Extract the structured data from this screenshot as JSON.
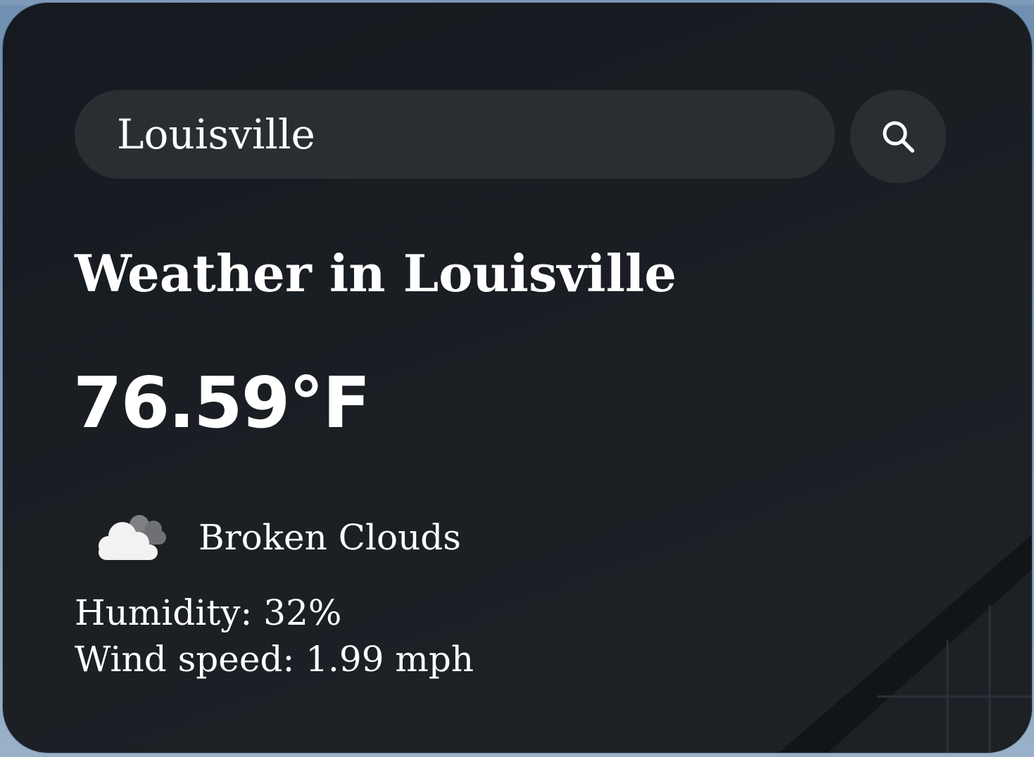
{
  "search": {
    "value": "Louisville",
    "button_icon": "search-icon"
  },
  "weather": {
    "title": "Weather in Louisville",
    "temperature": "76.59°F",
    "condition_icon": "broken-clouds-icon",
    "condition": "Broken Clouds",
    "humidity": "Humidity: 32%",
    "wind_speed": "Wind speed: 1.99 mph"
  },
  "colors": {
    "card_background": "#1b1f24",
    "field_background": "#2a2e33",
    "text": "#ffffff",
    "page_background": "#7f9cba"
  }
}
